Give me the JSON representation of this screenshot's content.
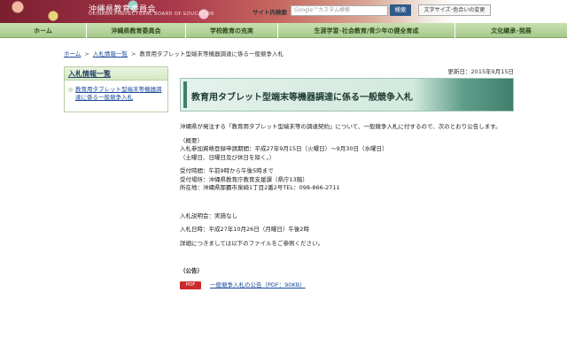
{
  "header": {
    "title": "沖縄県教育委員会",
    "subtitle": "OKINAWA PREFECTURAL BOARD OF EDUCATION",
    "search_label": "サイト内検索",
    "search_placeholder": "Google™カスタム検索",
    "search_button": "検索",
    "text_size_button": "文字サイズ･色合いの変更"
  },
  "nav": {
    "items": [
      {
        "label": "ホーム"
      },
      {
        "label": "沖縄県教育委員会"
      },
      {
        "label": "学校教育の充実"
      },
      {
        "label": "生涯学習･社会教育/青少年の健全育成"
      },
      {
        "label": "文化継承･発展"
      }
    ]
  },
  "breadcrumb": {
    "home": "ホーム",
    "sep1": ">",
    "list": "入札情報一覧",
    "sep2": ">",
    "current": "教育用タブレット型端末等機器調達に係る一般競争入札"
  },
  "sidebar": {
    "heading": "入札情報一覧",
    "items": [
      {
        "label": "教育用タブレット型端末等機器調達に係る一般競争入札"
      }
    ]
  },
  "main": {
    "updated": "更新日：2015年9月15日",
    "title": "教育用タブレット型端末等機器調達に係る一般競争入札",
    "intro": "沖縄県が発注する「教育用タブレット型端末等の調達契約」について、一般競争入札に付するので、次のとおり公告します。",
    "overview_heading": "（概要）",
    "registration_period": "入札参加資格登録申請期間：平成27年9月15日（火曜日）～9月30日（水曜日）",
    "registration_note": "（土曜日、日曜日及び休日を除く。）",
    "reception_hours": "受付時間：午前9時から午後5時まで",
    "reception_place": "受付場所：沖縄県教育庁教育支援課（県庁13階）",
    "address": "所在地：沖縄県那覇市泉崎1丁目2番2号TEL：098-866-2711",
    "briefing": "入札説明会：実施なし",
    "bid_date": "入札日時：平成27年10月26日（月曜日）午後2時",
    "details_note": "詳細につきましては以下のファイルをご参照ください。",
    "notice_heading": "（公告）",
    "file_type": "PDF",
    "file_link": "一般競争入札の公告（PDF：90KB）"
  }
}
